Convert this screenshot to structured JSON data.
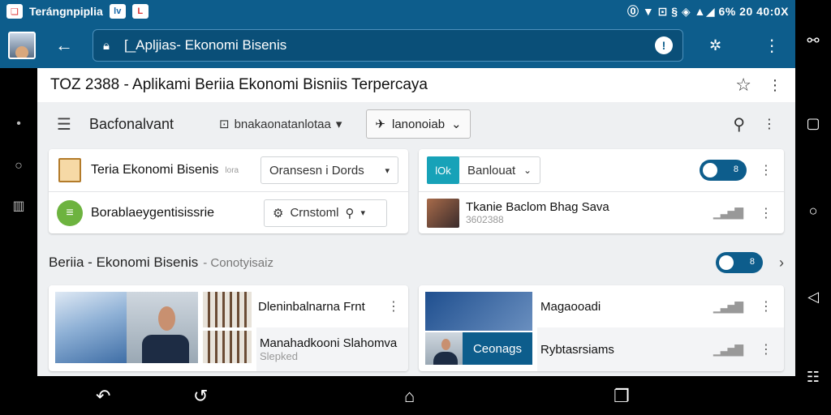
{
  "statusbar": {
    "app_name": "Terángnpiplia",
    "icon1": "lv",
    "icon2": "L",
    "indicators": "⓪ ▼ ⊡ § ◈ ▲◢ 6% 20 40:0X",
    "time": "6% 20 40:0X"
  },
  "appbar": {
    "url_text": "[_Apljias- Ekonomi Bisenis",
    "info_label": "!"
  },
  "page": {
    "title": "TOZ 2388 -  Aplikami Beriia Ekonomi Bisniis Terpercaya"
  },
  "toolbar": {
    "home_label": "Bacfonalvant",
    "dropdown_label": "bnakaonatanlotaa",
    "button_label": "lanonoiab"
  },
  "card_left": {
    "row1_title": "Teria Ekonomi Bisenis",
    "row1_tag": "lora",
    "row1_select": "Oransesn i  Dords",
    "row2_title": "Borablaeygentisissrie",
    "row2_select": "Crnstoml"
  },
  "card_right": {
    "badge": "lOk",
    "select_label": "Banlouat",
    "toggle_label": "8",
    "news_title": "Tkanie Baclom Bhag Sava",
    "news_sub": "3602388"
  },
  "section": {
    "title": "Beriia - Ekonomi Bisenis",
    "subtitle": "- Conotyisaiz",
    "toggle_label": "8"
  },
  "news_left": {
    "item1_title": "Dleninbalnarna Frnt",
    "item2_title": "Manahadkooni Slahomva",
    "item2_sub": "Slepked"
  },
  "news_right": {
    "item1_title": "Magaooadi",
    "badge_label": "Ceonags",
    "item2_title": "Rybtasrsiams"
  },
  "icons": {
    "back": "back-arrow-icon",
    "lock": "lock-icon",
    "extension": "extension-icon",
    "menu": "menu-dots-icon",
    "star": "star-icon",
    "search": "search-icon",
    "hamburger": "hamburger-icon"
  },
  "colors": {
    "primary": "#0d5d8c",
    "teal": "#17a2b8",
    "green": "#6db33f"
  }
}
